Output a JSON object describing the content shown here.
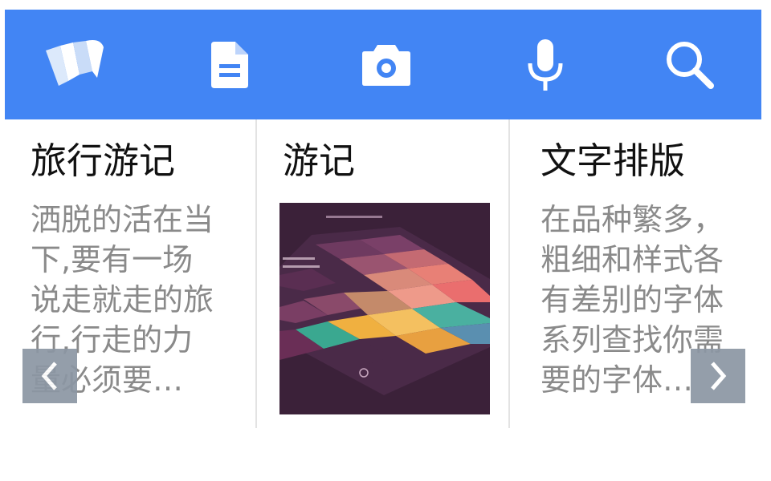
{
  "toolbar": {
    "background": "#4285f4",
    "buttons": [
      {
        "icon": "wiz-logo-icon"
      },
      {
        "icon": "document-icon"
      },
      {
        "icon": "camera-icon"
      },
      {
        "icon": "microphone-icon"
      },
      {
        "icon": "search-icon"
      }
    ]
  },
  "cards": [
    {
      "title": "旅行游记",
      "text": "洒脱的活在当下,要有一场说走就走的旅行,行走的力量必须要…"
    },
    {
      "title": "游记",
      "image": "travel-app-color-tiles-image"
    },
    {
      "title": "文字排版",
      "text": "在品种繁多，粗细和样式各有差别的字体系列查找你需要的字体…"
    }
  ],
  "nav": {
    "prev_icon": "chevron-left-icon",
    "next_icon": "chevron-right-icon"
  }
}
